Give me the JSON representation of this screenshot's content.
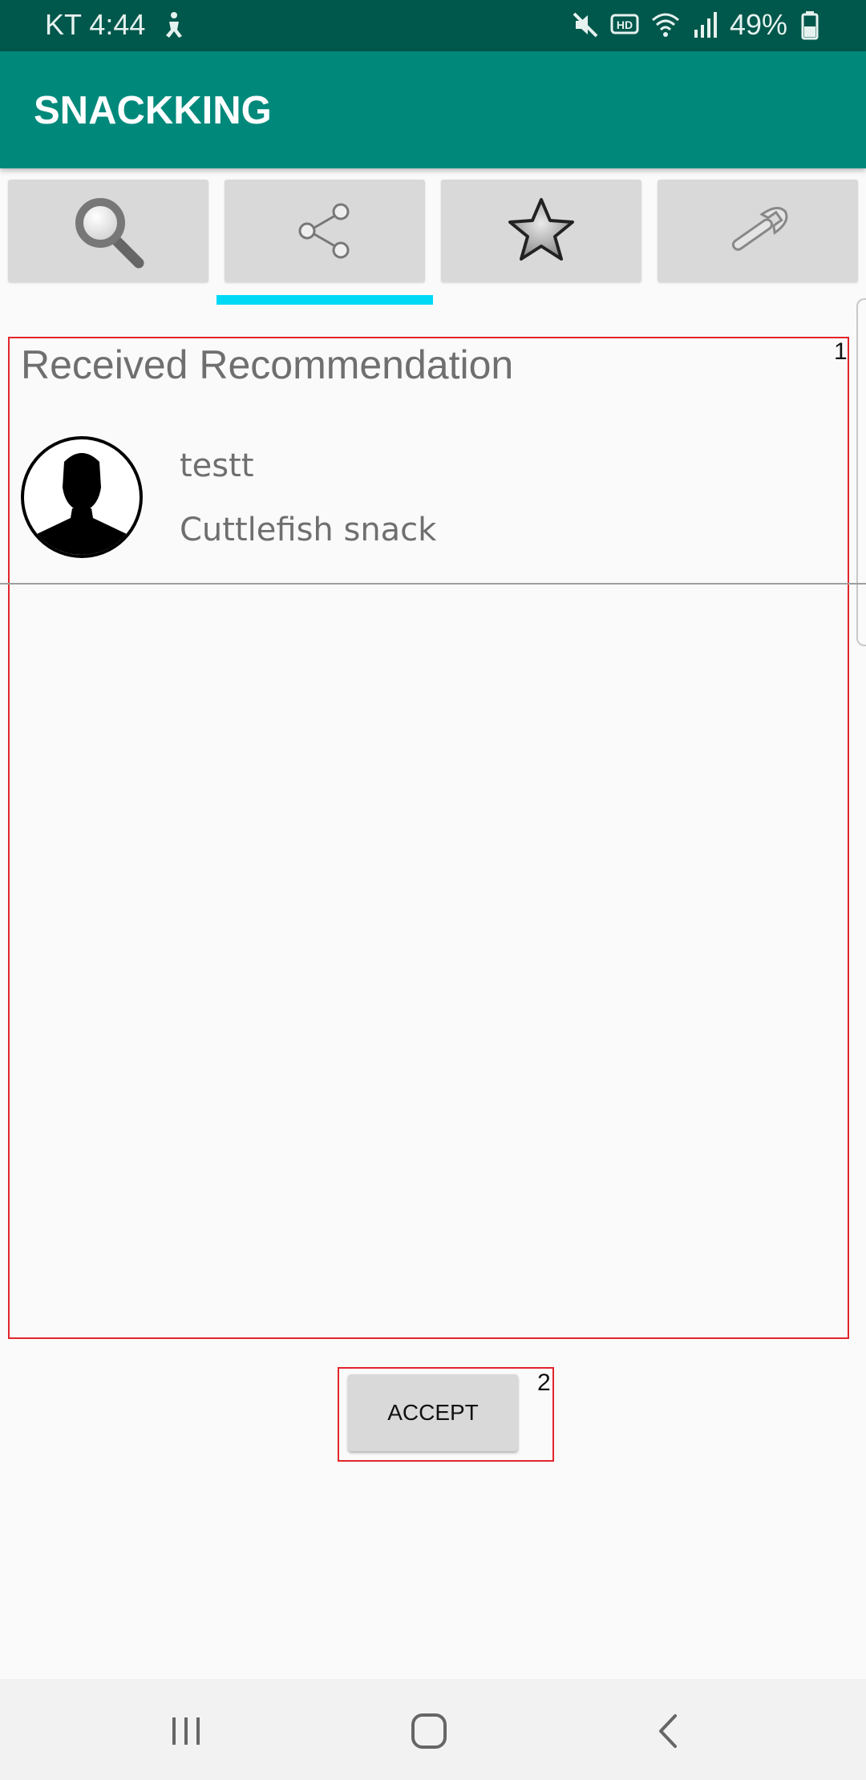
{
  "status_bar": {
    "carrier_time": "KT 4:44",
    "battery": "49%",
    "icons": [
      "accessibility-icon",
      "mute-icon",
      "hd-icon",
      "wifi-icon",
      "signal-icon",
      "battery-icon"
    ]
  },
  "app_bar": {
    "title": "SNACKKING"
  },
  "tabs": [
    {
      "icon": "search-icon",
      "selected": false
    },
    {
      "icon": "share-icon",
      "selected": true
    },
    {
      "icon": "star-icon",
      "selected": false
    },
    {
      "icon": "wrench-icon",
      "selected": false
    }
  ],
  "colors": {
    "status_bar": "#00574b",
    "app_bar": "#00897b",
    "tab_indicator": "#00d9f5",
    "highlight_box": "#e2252b"
  },
  "recommendation": {
    "section_title": "Received Recommendation",
    "items": [
      {
        "name": "testt",
        "snack": "Cuttlefish snack"
      }
    ]
  },
  "accept_button": {
    "label": "ACCEPT"
  },
  "markers": {
    "section": "1",
    "button": "2"
  },
  "nav_bar": {
    "icons": [
      "recent-apps-icon",
      "home-icon",
      "back-icon"
    ]
  }
}
